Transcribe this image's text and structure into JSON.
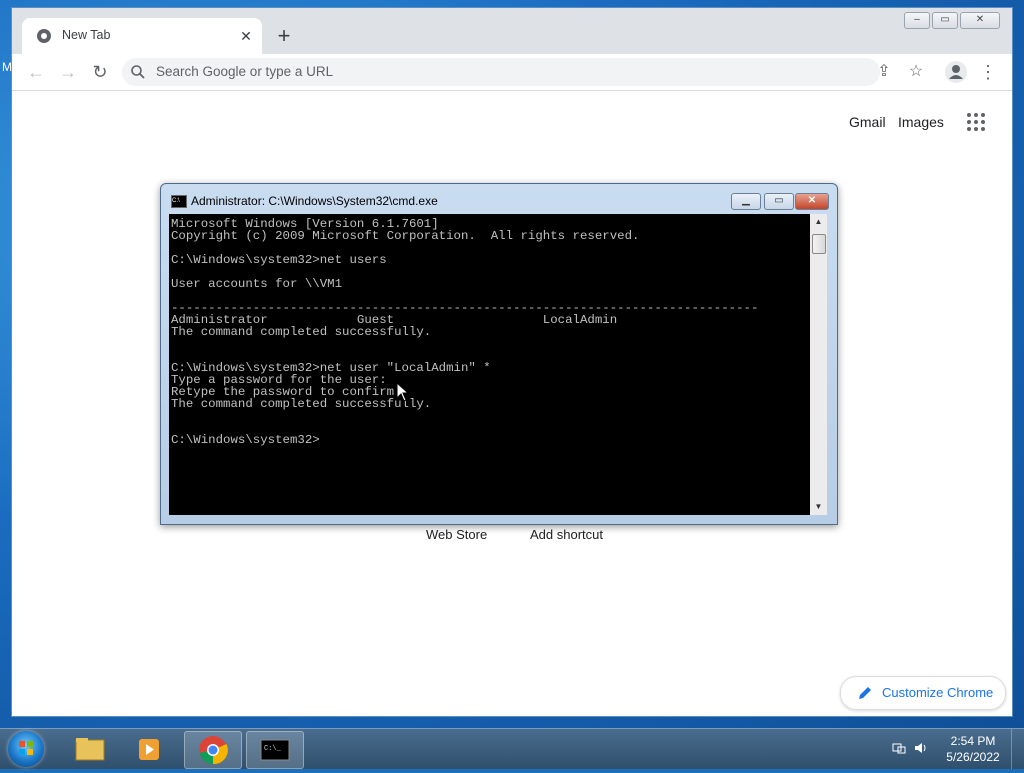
{
  "browser": {
    "tab_title": "New Tab",
    "tab_close": "✕",
    "new_tab": "+",
    "omnibox_placeholder": "Search Google or type a URL",
    "back": "←",
    "forward": "→",
    "reload": "↻",
    "share": "⇪",
    "bookmark": "☆",
    "menu": "⋮",
    "window_buttons": {
      "minimize": "–",
      "restore": "▭",
      "close": "✕"
    }
  },
  "ntp": {
    "gmail": "Gmail",
    "images": "Images",
    "shortcuts": [
      "Web Store",
      "Add shortcut"
    ],
    "customize_label": "Customize Chrome"
  },
  "cmd": {
    "title": "Administrator: C:\\Windows\\System32\\cmd.exe",
    "icon_text": "C:\\",
    "buttons": {
      "minimize": "▁",
      "restore": "▭",
      "close": "✕"
    },
    "console_text": "Microsoft Windows [Version 6.1.7601]\nCopyright (c) 2009 Microsoft Corporation.  All rights reserved.\n\nC:\\Windows\\system32>net users\n\nUser accounts for \\\\VM1\n\n-------------------------------------------------------------------------------\nAdministrator            Guest                    LocalAdmin\nThe command completed successfully.\n\n\nC:\\Windows\\system32>net user \"LocalAdmin\" *\nType a password for the user:\nRetype the password to confirm:\nThe command completed successfully.\n\n\nC:\\Windows\\system32>",
    "scroll_up": "▲",
    "scroll_down": "▼"
  },
  "taskbar": {
    "time": "2:54 PM",
    "date": "5/26/2022",
    "apps": [
      "file-explorer",
      "media-player",
      "chrome",
      "command-prompt"
    ]
  }
}
